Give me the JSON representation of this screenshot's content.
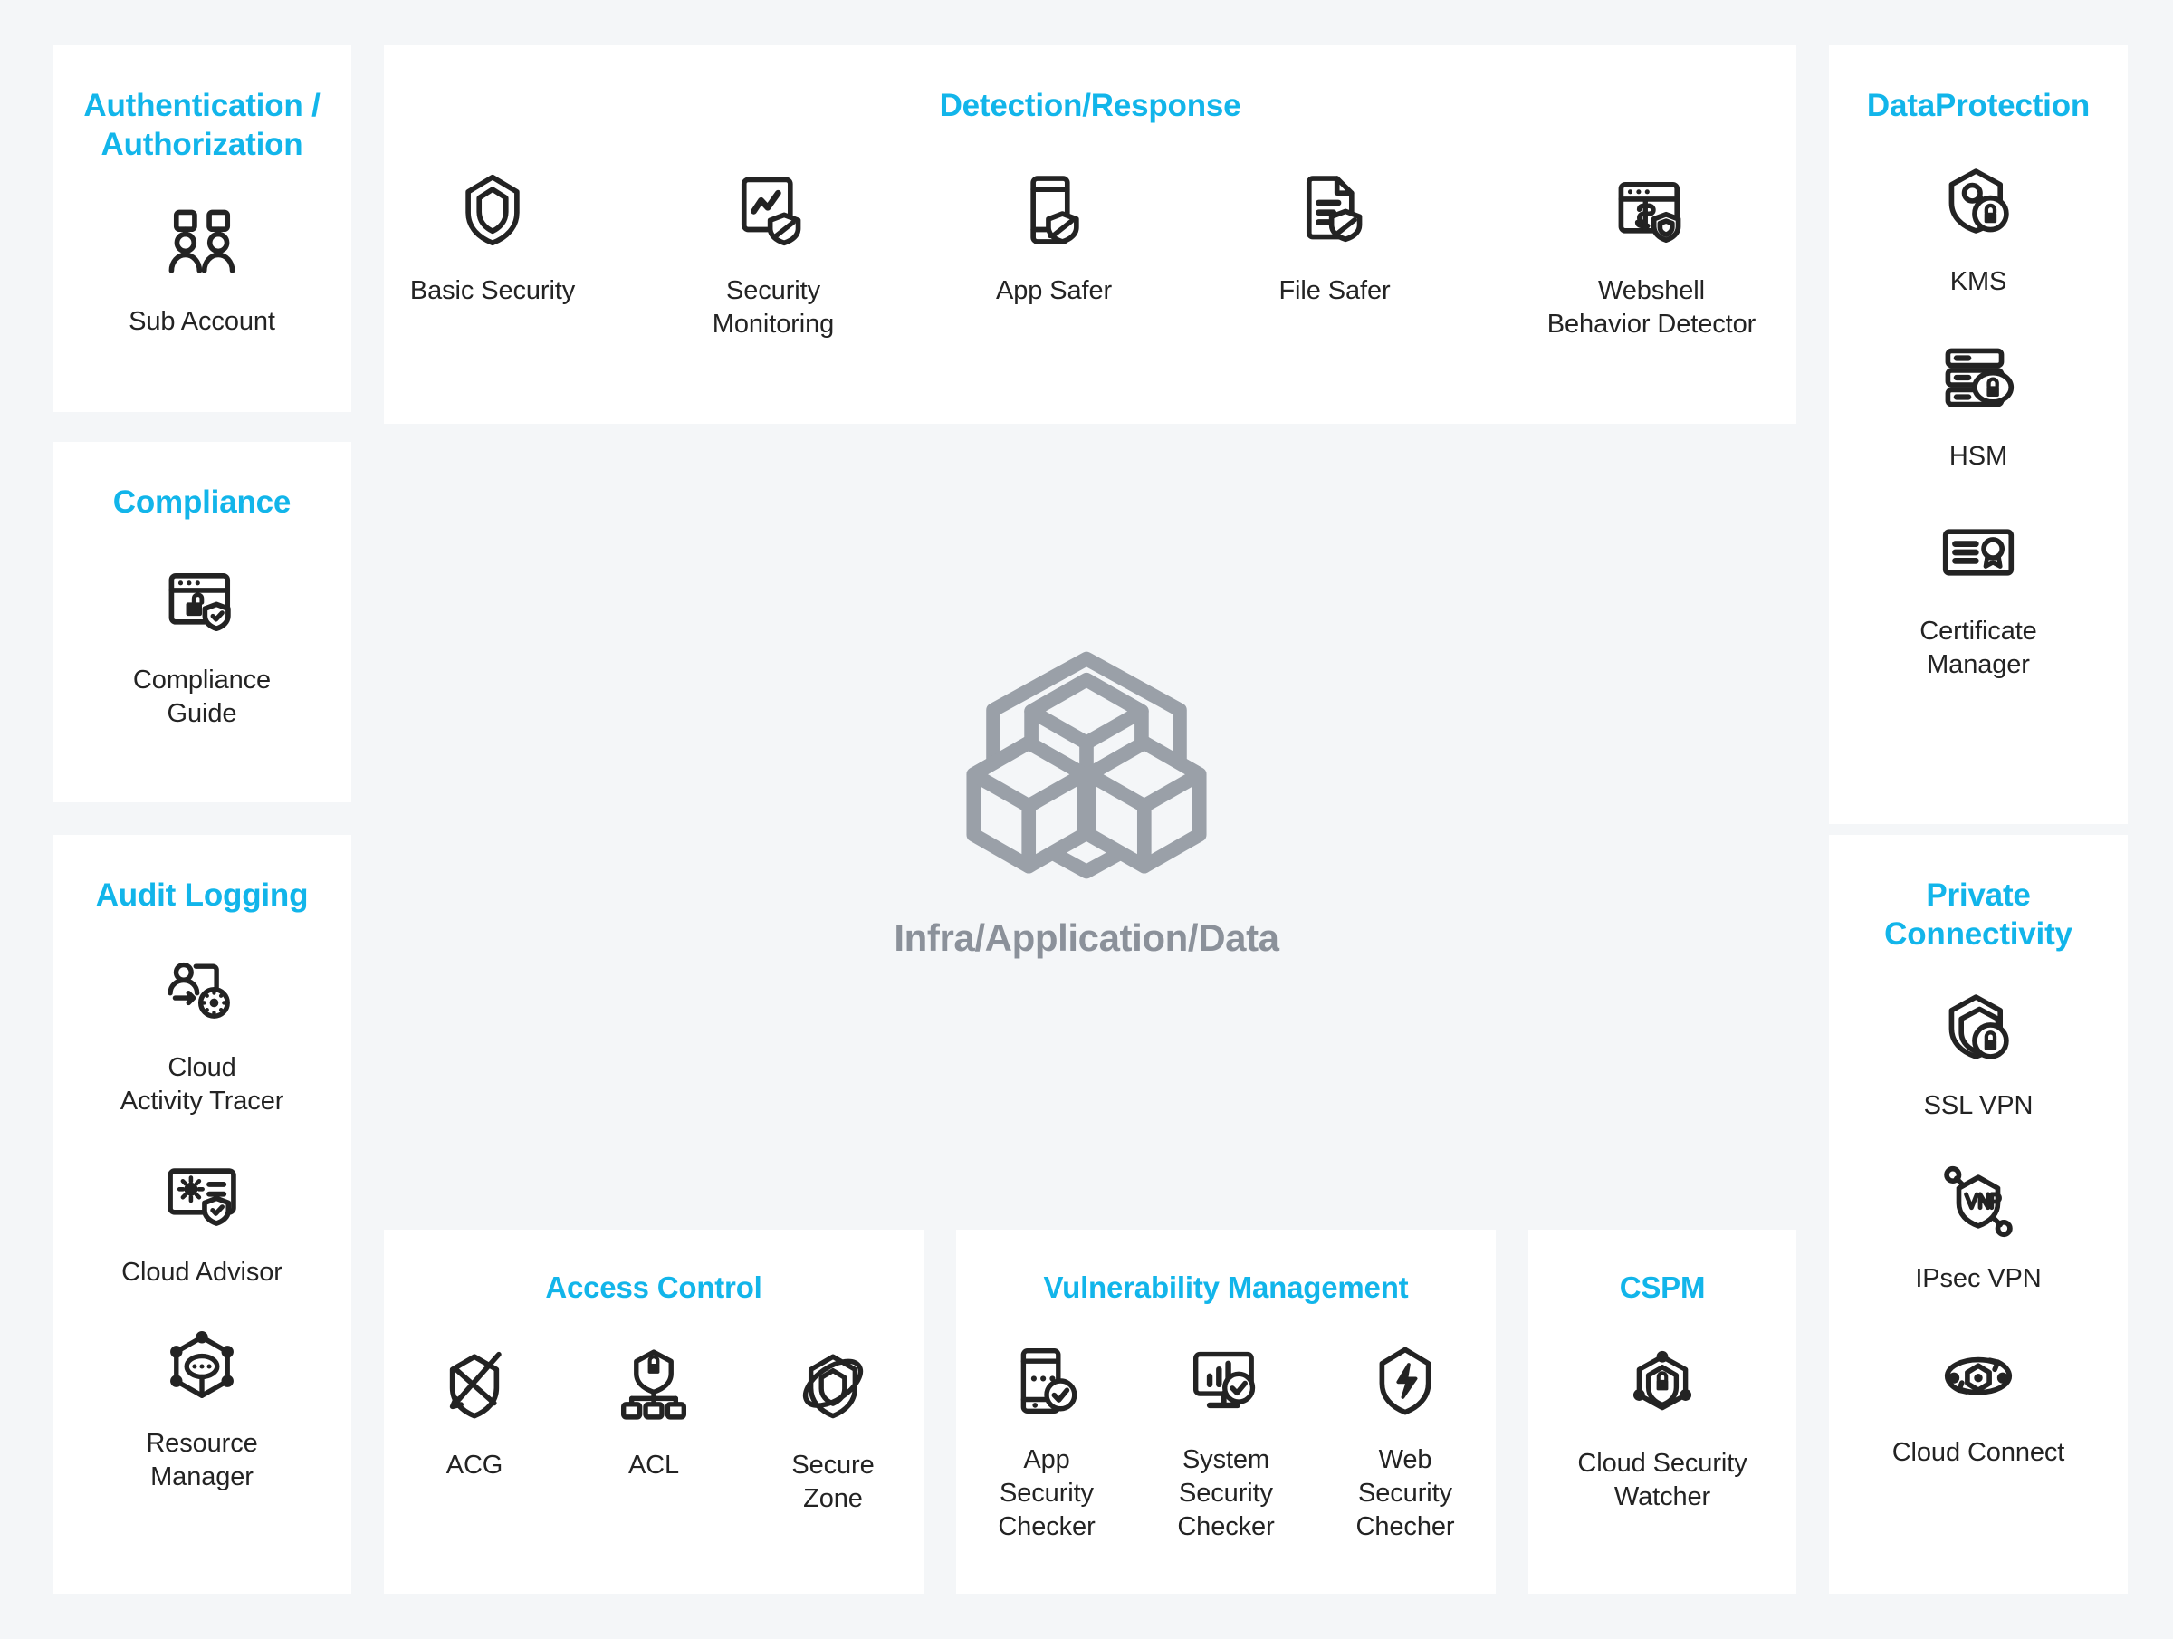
{
  "theme": {
    "accent": "#12b5ea",
    "background": "#f4f6f8",
    "card_background": "#ffffff",
    "icon_color": "#232323",
    "center_color": "#9aa0a8"
  },
  "center": {
    "label": "Infra/Application/Data",
    "icon": "three-cubes-hexagon-icon"
  },
  "sections": {
    "authentication": {
      "title": "Authentication /\nAuthorization",
      "title_line1": "Authentication /",
      "title_line2": "Authorization",
      "items": [
        {
          "label": "Sub Account",
          "icon": "two-users-icon"
        }
      ]
    },
    "compliance": {
      "title": "Compliance",
      "items": [
        {
          "label": "Compliance\nGuide",
          "line1": "Compliance",
          "line2": "Guide",
          "icon": "browser-lock-shield-icon"
        }
      ]
    },
    "audit_logging": {
      "title": "Audit Logging",
      "items": [
        {
          "label": "Cloud\nActivity Tracer",
          "line1": "Cloud",
          "line2": "Activity Tracer",
          "icon": "users-gear-document-icon"
        },
        {
          "label": "Cloud Advisor",
          "line1": "Cloud Advisor",
          "line2": "",
          "icon": "monitor-gear-shield-check-icon"
        },
        {
          "label": "Resource\nManager",
          "line1": "Resource",
          "line2": "Manager",
          "icon": "network-nodes-icon"
        }
      ]
    },
    "detection_response": {
      "title": "Detection/Response",
      "items": [
        {
          "label": "Basic Security",
          "line1": "Basic Security",
          "line2": "",
          "icon": "shield-outline-icon"
        },
        {
          "label": "Security\nMonitoring",
          "line1": "Security",
          "line2": "Monitoring",
          "icon": "chart-document-shield-icon"
        },
        {
          "label": "App Safer",
          "line1": "App Safer",
          "line2": "",
          "icon": "mobile-shield-icon"
        },
        {
          "label": "File Safer",
          "line1": "File Safer",
          "line2": "",
          "icon": "file-shield-icon"
        },
        {
          "label": "Webshell\nBehavior Detector",
          "line1": "Webshell",
          "line2": "Behavior Detector",
          "icon": "browser-dollar-shield-icon"
        }
      ]
    },
    "access_control": {
      "title": "Access Control",
      "items": [
        {
          "label": "ACG",
          "line1": "ACG",
          "line2": "",
          "icon": "shield-arrow-cross-icon"
        },
        {
          "label": "ACL",
          "line1": "ACL",
          "line2": "",
          "icon": "shield-lock-hierarchy-icon"
        },
        {
          "label": "Secure\nZone",
          "line1": "Secure",
          "line2": "Zone",
          "icon": "shield-orbit-icon"
        }
      ]
    },
    "vulnerability_management": {
      "title": "Vulnerability Management",
      "items": [
        {
          "label": "App\nSecurity\nChecker",
          "line1": "App",
          "line2": "Security",
          "line3": "Checker",
          "icon": "mobile-check-icon"
        },
        {
          "label": "System\nSecurity\nChecker",
          "line1": "System",
          "line2": "Security",
          "line3": "Checker",
          "icon": "monitor-chart-check-icon"
        },
        {
          "label": "Web\nSecurity\nChecher",
          "line1": "Web",
          "line2": "Security",
          "line3": "Checher",
          "icon": "shield-bolt-icon"
        }
      ]
    },
    "cspm": {
      "title": "CSPM",
      "items": [
        {
          "label": "Cloud Security\nWatcher",
          "line1": "Cloud Security",
          "line2": "Watcher",
          "icon": "hexagon-nodes-shield-lock-icon"
        }
      ]
    },
    "data_protection": {
      "title": "DataProtection",
      "items": [
        {
          "label": "KMS",
          "line1": "KMS",
          "line2": "",
          "icon": "shield-key-lock-icon"
        },
        {
          "label": "HSM",
          "line1": "HSM",
          "line2": "",
          "icon": "server-lock-icon"
        },
        {
          "label": "Certificate\nManager",
          "line1": "Certificate",
          "line2": "Manager",
          "icon": "certificate-icon"
        }
      ]
    },
    "private_connectivity": {
      "title": "Private\nConnectivity",
      "title_line1": "Private",
      "title_line2": "Connectivity",
      "items": [
        {
          "label": "SSL VPN",
          "line1": "SSL VPN",
          "line2": "",
          "icon": "shield-lock-layered-icon"
        },
        {
          "label": "IPsec VPN",
          "line1": "IPsec VPN",
          "line2": "",
          "icon": "vpn-shield-nodes-icon"
        },
        {
          "label": "Cloud Connect",
          "line1": "Cloud Connect",
          "line2": "",
          "icon": "connect-orbit-icon"
        }
      ]
    }
  }
}
